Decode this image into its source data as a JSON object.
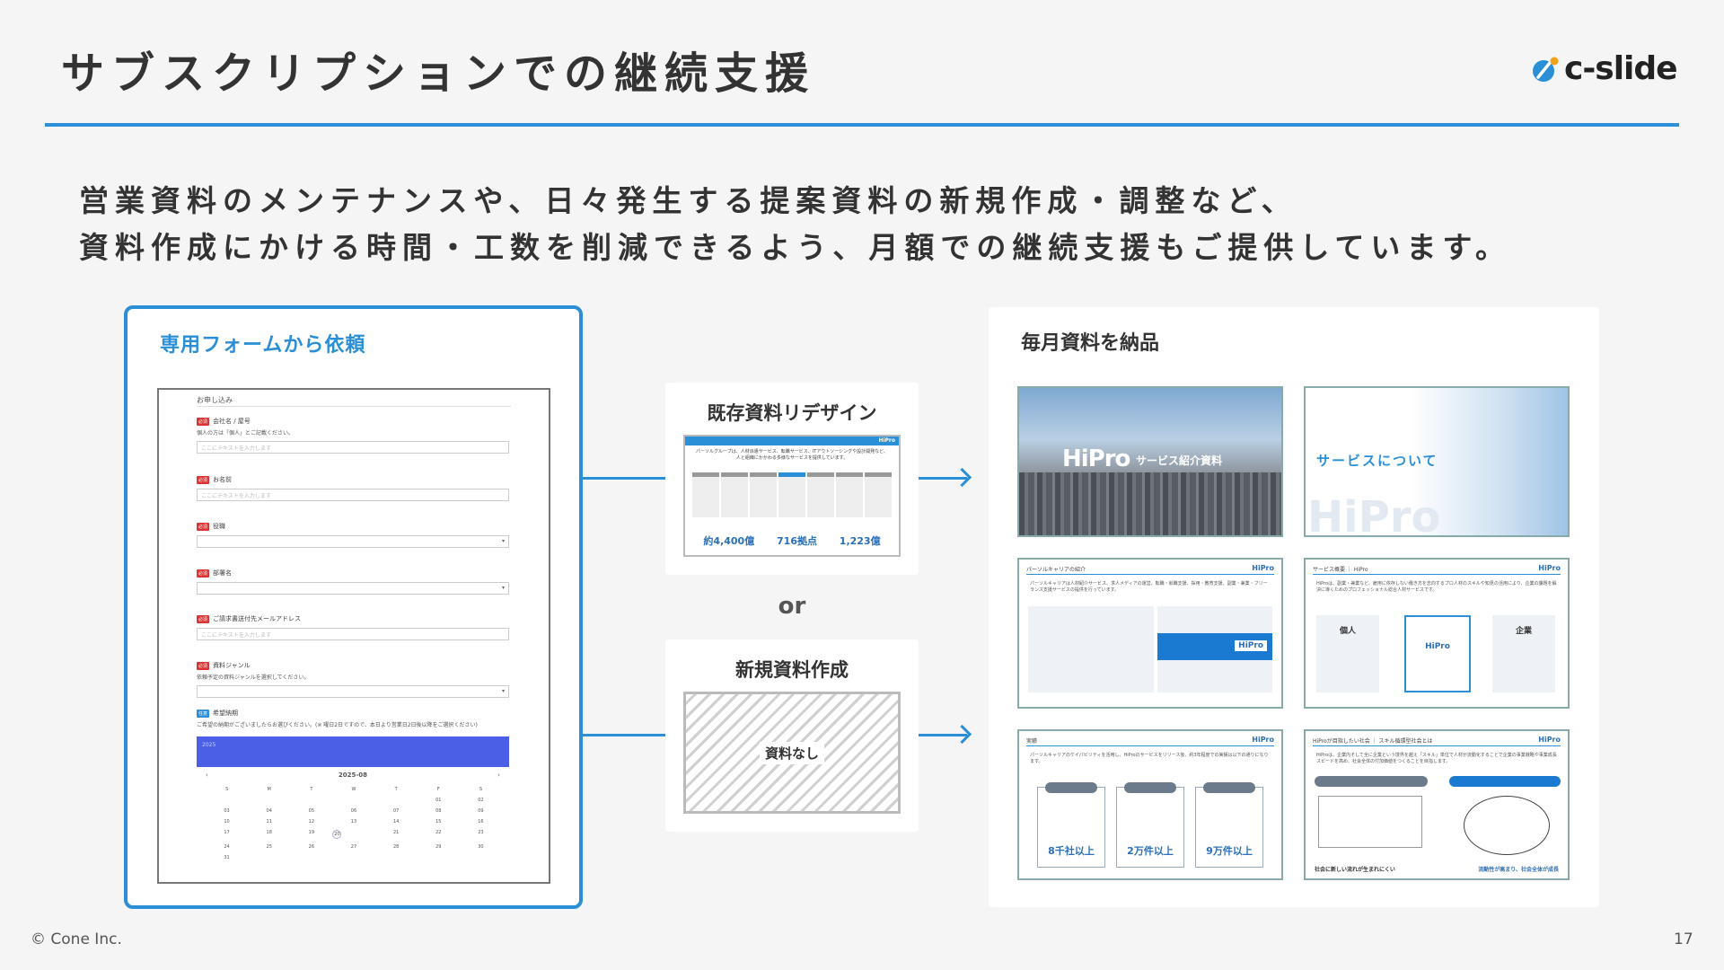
{
  "header": {
    "title": "サブスクリプションでの継続支援",
    "logo_text": "c-slide",
    "logo_color": "#2a8fd6",
    "logo_accent": "#f4a11d"
  },
  "lead": {
    "line1": "営業資料のメンテナンスや、日々発生する提案資料の新規作成・調整など、",
    "line2": "資料作成にかける時間・工数を削減できるよう、月額での継続支援もご提供しています。"
  },
  "form_panel": {
    "title": "専用フォームから依頼",
    "heading": "お申し込み",
    "fields": [
      {
        "badge": "必須",
        "label": "会社名 / 屋号",
        "hint": "個人の方は「個人」とご記載ください。",
        "placeholder": "ここにテキストを入力します"
      },
      {
        "badge": "必須",
        "label": "お名前",
        "placeholder": "ここにテキストを入力します"
      },
      {
        "badge": "必須",
        "label": "役職",
        "placeholder": ""
      },
      {
        "badge": "必須",
        "label": "部署名",
        "placeholder": ""
      },
      {
        "badge": "必須",
        "label": "ご請求書送付先メールアドレス",
        "placeholder": "ここにテキストを入力します"
      },
      {
        "badge": "必須",
        "label": "資料ジャンル",
        "hint": "依頼予定の資料ジャンルを選択してください。",
        "placeholder": ""
      }
    ],
    "deadline": {
      "badge": "任意",
      "label": "希望納期",
      "hint": "ご希望の納期がございましたらお選びください。(※ 曜日2日ですので、本日より営業日2日後以降をご選択ください)",
      "selected_year": "2025",
      "month": "2025-08",
      "weekdays": [
        "S",
        "M",
        "T",
        "W",
        "T",
        "F",
        "S"
      ],
      "days": [
        "",
        "",
        "",
        "",
        "",
        "01",
        "02",
        "03",
        "04",
        "05",
        "06",
        "07",
        "08",
        "09",
        "10",
        "11",
        "12",
        "13",
        "14",
        "15",
        "16",
        "17",
        "18",
        "19",
        "20",
        "21",
        "22",
        "23",
        "24",
        "25",
        "26",
        "27",
        "28",
        "29",
        "30",
        "31"
      ]
    }
  },
  "redesign": {
    "title": "既存資料リデザイン",
    "thumb_bar": "パーソルグループの概要",
    "thumb_brand": "HiPro",
    "thumb_sub": "パーソルグループは、人材派遣サービス、転職サービス、ITアウトソーシングや設計開発など、人と組織にかかわる多様なサービスを提供しています。",
    "thumb_stats": [
      "約4,400億",
      "716拠点",
      "1,223億"
    ]
  },
  "or_label": "or",
  "new_doc": {
    "title": "新規資料作成",
    "placeholder": "資料なし"
  },
  "delivery": {
    "title": "毎月資料を納品",
    "slides": [
      {
        "brand": "HiPro",
        "subtitle": "サービス紹介資料"
      },
      {
        "title": "サービスについて",
        "watermark": "HiPro"
      },
      {
        "header": "パーソルキャリアの紹介",
        "brand": "HiPro",
        "text": "パーソルキャリアは人材紹介サービス、求人メディアの運営、転職・就職支援、採用・教育支援、副業・兼業・フリーランス支援サービスの提供を行っています。",
        "highlight": "HiPro"
      },
      {
        "header": "サービス概要 ｜ HiPro",
        "brand": "HiPro",
        "text": "HiProは、副業・兼業など、雇用に依存しない働き方を志向するプロ人材のスキルや知見の活用により、企業の課題を解決に導くためのプロフェッショナル総合人材サービスです。",
        "left": "個人",
        "center": "HiPro",
        "right": "企業"
      },
      {
        "header": "実績",
        "brand": "HiPro",
        "text": "パーソルキャリアのケイパビリティを活用し、HiProのサービスをリリース後、約3年程度での実績は以下の通りになります。",
        "values": [
          "8千社以上",
          "2万件以上",
          "9万件以上"
        ]
      },
      {
        "header": "HiProが目指したい社会 ｜ スキル循環型社会とは",
        "brand": "HiPro",
        "text": "HiProは、企業内そして全に企業という境界を越え「スキル」単位で人材が流動化することで企業の事業戦略や事業成長スピードを高め、社会全体の付加価値をつくることを目指します。",
        "left_tag": "いままでの社会",
        "right_tag": "スキル循環型社会",
        "left_caption": "社会に新しい流れが生まれにくい",
        "right_caption": "流動性が高まり、社会全体が成長"
      }
    ]
  },
  "footer": {
    "copyright": "© Cone Inc.",
    "page": "17"
  }
}
